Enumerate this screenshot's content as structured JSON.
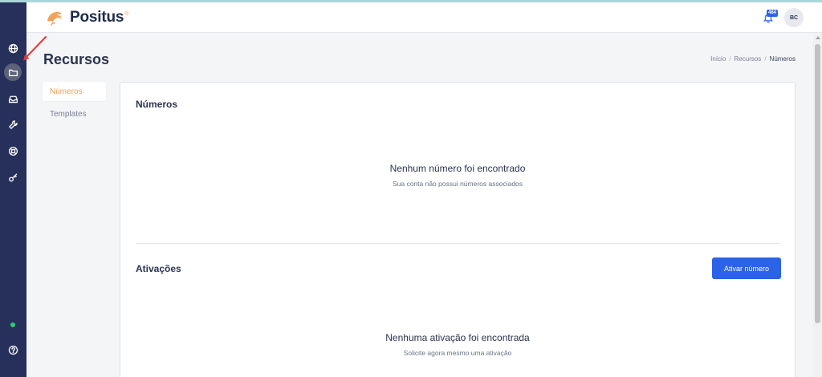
{
  "app": {
    "brand": "Positus",
    "brand_mark": "®"
  },
  "colors": {
    "rail": "#27305a",
    "accent": "#2b63e8",
    "active_tab": "#f0a05a",
    "status_online": "#2ecc71",
    "annotation": "#e53935"
  },
  "rail": {
    "items": [
      {
        "icon": "globe-icon",
        "active": false
      },
      {
        "icon": "folder-icon",
        "active": true
      },
      {
        "icon": "inbox-icon",
        "active": false
      },
      {
        "icon": "wrench-icon",
        "active": false
      },
      {
        "icon": "lifebuoy-icon",
        "active": false
      },
      {
        "icon": "key-icon",
        "active": false
      }
    ],
    "bottom": {
      "icon": "help-circle-icon"
    }
  },
  "header": {
    "notification_count": "484",
    "avatar_initials": "BC"
  },
  "page": {
    "title": "Recursos",
    "breadcrumb": [
      "Início",
      "/",
      "Recursos",
      "/",
      "Números"
    ]
  },
  "subnav": {
    "items": [
      "Números",
      "Templates"
    ],
    "active": "Números"
  },
  "numeros": {
    "title": "Números",
    "empty_title": "Nenhum número foi encontrado",
    "empty_subtitle": "Sua conta não possui números associados"
  },
  "ativacoes": {
    "title": "Ativações",
    "button_label": "Ativar número",
    "empty_title": "Nenhuma ativação foi encontrada",
    "empty_subtitle": "Solicite agora mesmo uma ativação"
  }
}
